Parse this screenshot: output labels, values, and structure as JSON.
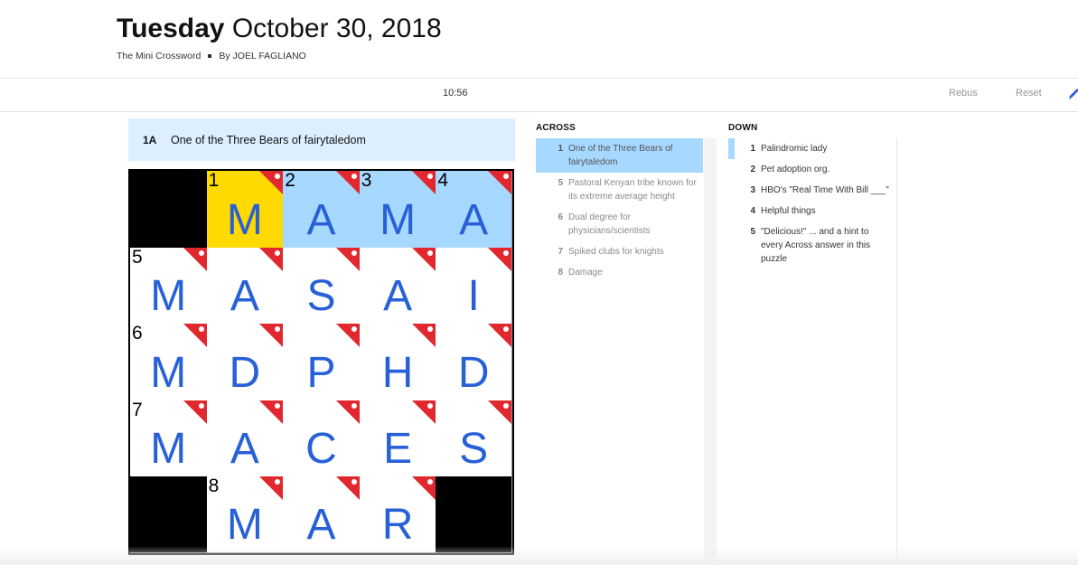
{
  "header": {
    "day": "Tuesday",
    "date": "October 30, 2018",
    "puzzle_name": "The Mini Crossword",
    "author": "By JOEL FAGLIANO"
  },
  "toolbar": {
    "timer": "10:56",
    "rebus_label": "Rebus",
    "reset_label": "Reset",
    "pencil_icon": "pencil-icon"
  },
  "current_clue": {
    "label": "1A",
    "text": "One of the Three Bears of fairytaledom"
  },
  "colors": {
    "active_cell": "#ffda00",
    "highlighted_word": "#a7d8ff",
    "clue_bar": "#dcefff",
    "letter": "#2860d8",
    "revealed_flag": "#e0282e"
  },
  "grid": {
    "rows": [
      [
        {
          "block": true
        },
        {
          "num": "1",
          "letter": "M",
          "state": "active",
          "flag": true
        },
        {
          "num": "2",
          "letter": "A",
          "state": "word",
          "flag": true
        },
        {
          "num": "3",
          "letter": "M",
          "state": "word",
          "flag": true
        },
        {
          "num": "4",
          "letter": "A",
          "state": "word",
          "flag": true
        }
      ],
      [
        {
          "num": "5",
          "letter": "M",
          "flag": true
        },
        {
          "letter": "A",
          "flag": true
        },
        {
          "letter": "S",
          "flag": true
        },
        {
          "letter": "A",
          "flag": true
        },
        {
          "letter": "I",
          "flag": true
        }
      ],
      [
        {
          "num": "6",
          "letter": "M",
          "flag": true
        },
        {
          "letter": "D",
          "flag": true
        },
        {
          "letter": "P",
          "flag": true
        },
        {
          "letter": "H",
          "flag": true
        },
        {
          "letter": "D",
          "flag": true
        }
      ],
      [
        {
          "num": "7",
          "letter": "M",
          "flag": true
        },
        {
          "letter": "A",
          "flag": true
        },
        {
          "letter": "C",
          "flag": true
        },
        {
          "letter": "E",
          "flag": true
        },
        {
          "letter": "S",
          "flag": true
        }
      ],
      [
        {
          "block": true
        },
        {
          "num": "8",
          "letter": "M",
          "flag": true
        },
        {
          "letter": "A",
          "flag": true
        },
        {
          "letter": "R",
          "flag": true
        },
        {
          "block": true
        }
      ]
    ]
  },
  "across": {
    "heading": "ACROSS",
    "clues": [
      {
        "num": "1",
        "text": "One of the Three Bears of fairytaledom",
        "state": "sel"
      },
      {
        "num": "5",
        "text": "Pastoral Kenyan tribe known for its extreme average height",
        "state": "dim"
      },
      {
        "num": "6",
        "text": "Dual degree for physicians/scientists",
        "state": "dim"
      },
      {
        "num": "7",
        "text": "Spiked clubs for knights",
        "state": "dim"
      },
      {
        "num": "8",
        "text": "Damage",
        "state": "dim"
      }
    ]
  },
  "down": {
    "heading": "DOWN",
    "clues": [
      {
        "num": "1",
        "text": "Palindromic lady",
        "state": ""
      },
      {
        "num": "2",
        "text": "Pet adoption org.",
        "state": ""
      },
      {
        "num": "3",
        "text": "HBO's \"Real Time With Bill ___\"",
        "state": ""
      },
      {
        "num": "4",
        "text": "Helpful things",
        "state": ""
      },
      {
        "num": "5",
        "text": "\"Delicious!\" ... and a hint to every Across answer in this puzzle",
        "state": ""
      }
    ]
  }
}
